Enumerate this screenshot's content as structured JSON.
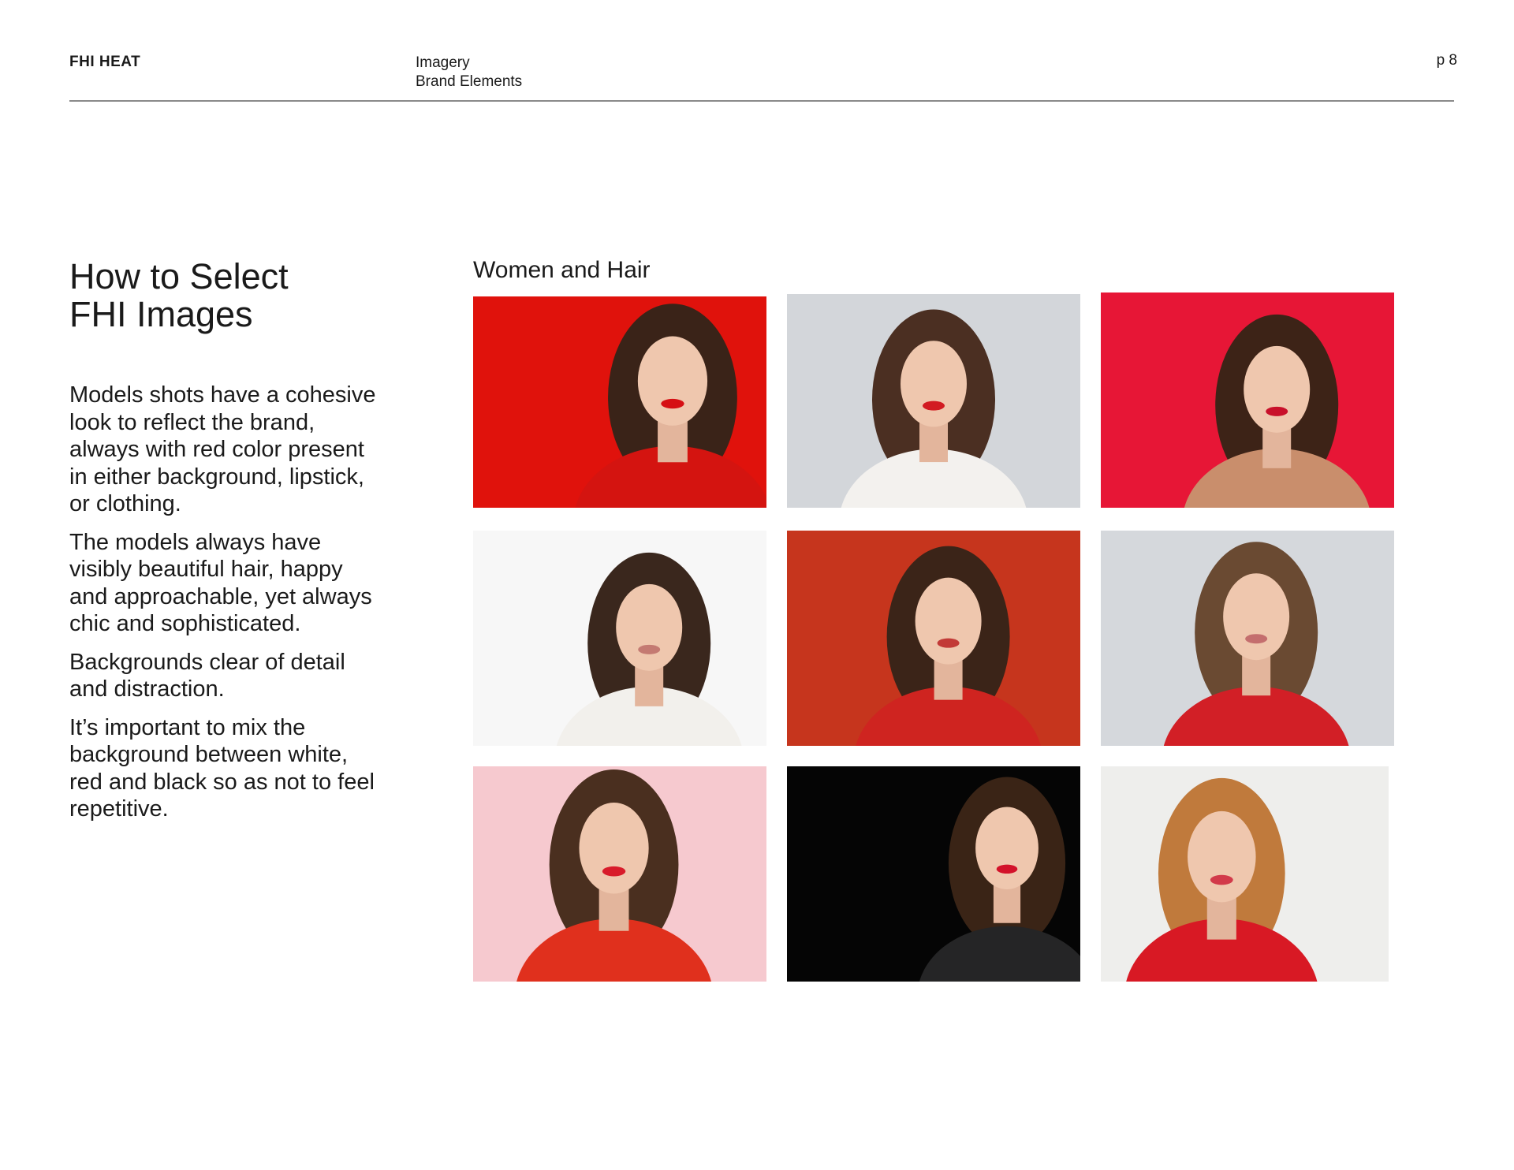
{
  "header": {
    "brand": "FHI HEAT",
    "section_line1": "Imagery",
    "section_line2": "Brand Elements",
    "page": "p 8"
  },
  "left": {
    "title_line1": "How to Select",
    "title_line2": "FHI Images",
    "paragraphs": [
      "Models shots have a cohesive look to reflect the brand, always with red color present in either background, lipstick, or clothing.",
      "The models always have visibly beautiful hair, happy and approachable, yet always chic and sophisticated.",
      "Backgrounds clear of detail and distraction.",
      "It’s important to mix the background between white, red and black so as not to feel repetitive."
    ]
  },
  "gallery": {
    "title": "Women and Hair",
    "photos": [
      {
        "bg": "#e0120c",
        "hair": "#3a2318",
        "top": "#d41410",
        "lips": "#d60f14"
      },
      {
        "bg": "#d3d6da",
        "hair": "#4b2f22",
        "top": "#f3f1ee",
        "lips": "#d21b22"
      },
      {
        "bg": "#e71636",
        "hair": "#3d2317",
        "top": "#c98e6c",
        "lips": "#c8102a"
      },
      {
        "bg": "#f7f7f7",
        "hair": "#3a271d",
        "top": "#f2f0ec",
        "lips": "#c47a72"
      },
      {
        "bg": "#c6351d",
        "hair": "#3b2418",
        "top": "#cf2420",
        "lips": "#c23a37"
      },
      {
        "bg": "#d5d8dc",
        "hair": "#6a4a32",
        "top": "#d21f26",
        "lips": "#c46e6e"
      },
      {
        "bg": "#f6c9cf",
        "hair": "#4a2f1f",
        "top": "#e0301d",
        "lips": "#d81b2a"
      },
      {
        "bg": "#050505",
        "hair": "#3a2416",
        "top": "#252526",
        "lips": "#d3122a"
      },
      {
        "bg": "#eeeeec",
        "hair": "#c07a3c",
        "top": "#d81924",
        "lips": "#d23a4a"
      }
    ]
  }
}
